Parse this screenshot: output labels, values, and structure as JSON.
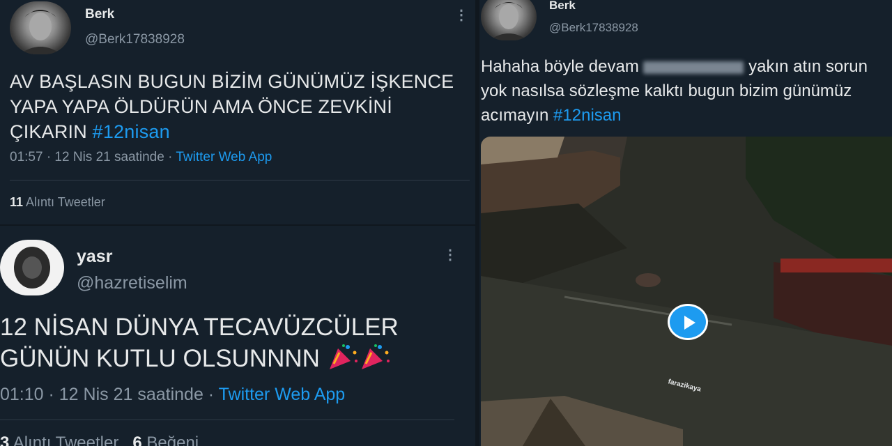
{
  "tweet1": {
    "name": "Berk",
    "handle": "@Berk17838928",
    "text": "AV BAŞLASIN BUGUN BİZİM GÜNÜMÜZ İŞKENCE YAPA YAPA ÖLDÜRÜN AMA ÖNCE ZEVKİNİ ÇIKARIN ",
    "hashtag": "#12nisan",
    "meta_time": "01:57 · 12 Nis 21 saatinde · ",
    "meta_app": "Twitter Web App",
    "quote_count": "11",
    "quote_label": " Alıntı Tweetler"
  },
  "tweet2": {
    "name": "yasr",
    "handle": "@hazretiselim",
    "line1": "12 NİSAN DÜNYA TECAVÜZCÜLER",
    "line2": "GÜNÜN KUTLU OLSUNNNN ",
    "meta_time": "01:10 · 12 Nis 21 saatinde · ",
    "meta_app": "Twitter Web App",
    "quote_count": "3",
    "quote_label": " Alıntı Tweetler",
    "like_count": "6",
    "like_label": " Beğeni"
  },
  "tweet3": {
    "name": "Berk",
    "handle": "@Berk17838928",
    "text_part1": "Hahaha böyle devam ",
    "text_part2": " yakın atın sorun yok nasılsa sözleşme kalktı bugun bizim günümüz acımayın ",
    "hashtag": "#12nisan",
    "watermark": "farazikaya"
  },
  "icons": {
    "more": "more-vertical-icon",
    "play": "play-icon",
    "party": "party-popper-icon"
  },
  "colors": {
    "background": "#15202b",
    "accent": "#1d9bf0",
    "secondary_text": "#8b98a5"
  }
}
